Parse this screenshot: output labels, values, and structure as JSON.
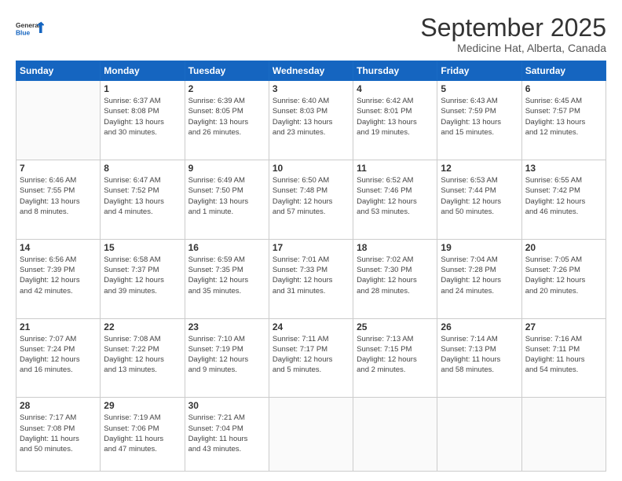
{
  "logo": {
    "line1": "General",
    "line2": "Blue"
  },
  "title": "September 2025",
  "subtitle": "Medicine Hat, Alberta, Canada",
  "days_header": [
    "Sunday",
    "Monday",
    "Tuesday",
    "Wednesday",
    "Thursday",
    "Friday",
    "Saturday"
  ],
  "weeks": [
    [
      {
        "day": "",
        "info": ""
      },
      {
        "day": "1",
        "info": "Sunrise: 6:37 AM\nSunset: 8:08 PM\nDaylight: 13 hours\nand 30 minutes."
      },
      {
        "day": "2",
        "info": "Sunrise: 6:39 AM\nSunset: 8:05 PM\nDaylight: 13 hours\nand 26 minutes."
      },
      {
        "day": "3",
        "info": "Sunrise: 6:40 AM\nSunset: 8:03 PM\nDaylight: 13 hours\nand 23 minutes."
      },
      {
        "day": "4",
        "info": "Sunrise: 6:42 AM\nSunset: 8:01 PM\nDaylight: 13 hours\nand 19 minutes."
      },
      {
        "day": "5",
        "info": "Sunrise: 6:43 AM\nSunset: 7:59 PM\nDaylight: 13 hours\nand 15 minutes."
      },
      {
        "day": "6",
        "info": "Sunrise: 6:45 AM\nSunset: 7:57 PM\nDaylight: 13 hours\nand 12 minutes."
      }
    ],
    [
      {
        "day": "7",
        "info": "Sunrise: 6:46 AM\nSunset: 7:55 PM\nDaylight: 13 hours\nand 8 minutes."
      },
      {
        "day": "8",
        "info": "Sunrise: 6:47 AM\nSunset: 7:52 PM\nDaylight: 13 hours\nand 4 minutes."
      },
      {
        "day": "9",
        "info": "Sunrise: 6:49 AM\nSunset: 7:50 PM\nDaylight: 13 hours\nand 1 minute."
      },
      {
        "day": "10",
        "info": "Sunrise: 6:50 AM\nSunset: 7:48 PM\nDaylight: 12 hours\nand 57 minutes."
      },
      {
        "day": "11",
        "info": "Sunrise: 6:52 AM\nSunset: 7:46 PM\nDaylight: 12 hours\nand 53 minutes."
      },
      {
        "day": "12",
        "info": "Sunrise: 6:53 AM\nSunset: 7:44 PM\nDaylight: 12 hours\nand 50 minutes."
      },
      {
        "day": "13",
        "info": "Sunrise: 6:55 AM\nSunset: 7:42 PM\nDaylight: 12 hours\nand 46 minutes."
      }
    ],
    [
      {
        "day": "14",
        "info": "Sunrise: 6:56 AM\nSunset: 7:39 PM\nDaylight: 12 hours\nand 42 minutes."
      },
      {
        "day": "15",
        "info": "Sunrise: 6:58 AM\nSunset: 7:37 PM\nDaylight: 12 hours\nand 39 minutes."
      },
      {
        "day": "16",
        "info": "Sunrise: 6:59 AM\nSunset: 7:35 PM\nDaylight: 12 hours\nand 35 minutes."
      },
      {
        "day": "17",
        "info": "Sunrise: 7:01 AM\nSunset: 7:33 PM\nDaylight: 12 hours\nand 31 minutes."
      },
      {
        "day": "18",
        "info": "Sunrise: 7:02 AM\nSunset: 7:30 PM\nDaylight: 12 hours\nand 28 minutes."
      },
      {
        "day": "19",
        "info": "Sunrise: 7:04 AM\nSunset: 7:28 PM\nDaylight: 12 hours\nand 24 minutes."
      },
      {
        "day": "20",
        "info": "Sunrise: 7:05 AM\nSunset: 7:26 PM\nDaylight: 12 hours\nand 20 minutes."
      }
    ],
    [
      {
        "day": "21",
        "info": "Sunrise: 7:07 AM\nSunset: 7:24 PM\nDaylight: 12 hours\nand 16 minutes."
      },
      {
        "day": "22",
        "info": "Sunrise: 7:08 AM\nSunset: 7:22 PM\nDaylight: 12 hours\nand 13 minutes."
      },
      {
        "day": "23",
        "info": "Sunrise: 7:10 AM\nSunset: 7:19 PM\nDaylight: 12 hours\nand 9 minutes."
      },
      {
        "day": "24",
        "info": "Sunrise: 7:11 AM\nSunset: 7:17 PM\nDaylight: 12 hours\nand 5 minutes."
      },
      {
        "day": "25",
        "info": "Sunrise: 7:13 AM\nSunset: 7:15 PM\nDaylight: 12 hours\nand 2 minutes."
      },
      {
        "day": "26",
        "info": "Sunrise: 7:14 AM\nSunset: 7:13 PM\nDaylight: 11 hours\nand 58 minutes."
      },
      {
        "day": "27",
        "info": "Sunrise: 7:16 AM\nSunset: 7:11 PM\nDaylight: 11 hours\nand 54 minutes."
      }
    ],
    [
      {
        "day": "28",
        "info": "Sunrise: 7:17 AM\nSunset: 7:08 PM\nDaylight: 11 hours\nand 50 minutes."
      },
      {
        "day": "29",
        "info": "Sunrise: 7:19 AM\nSunset: 7:06 PM\nDaylight: 11 hours\nand 47 minutes."
      },
      {
        "day": "30",
        "info": "Sunrise: 7:21 AM\nSunset: 7:04 PM\nDaylight: 11 hours\nand 43 minutes."
      },
      {
        "day": "",
        "info": ""
      },
      {
        "day": "",
        "info": ""
      },
      {
        "day": "",
        "info": ""
      },
      {
        "day": "",
        "info": ""
      }
    ]
  ]
}
